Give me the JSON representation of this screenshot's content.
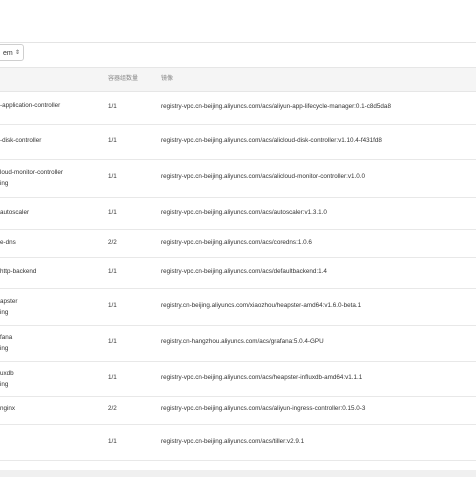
{
  "namespace_select": {
    "value": "em"
  },
  "table": {
    "headers": {
      "name": "",
      "count": "容器组数量",
      "image": "镜像"
    },
    "rows": [
      {
        "name": "-application-controller",
        "sub": "",
        "count": "1/1",
        "image": "registry-vpc.cn-beijing.aliyuncs.com/acs/aliyun-app-lifecycle-manager:0.1-c8d5da8"
      },
      {
        "name": "-disk-controller",
        "sub": "",
        "count": "1/1",
        "image": "registry-vpc.cn-beijing.aliyuncs.com/acs/alicloud-disk-controller:v1.10.4-f431fd8"
      },
      {
        "name": "loud-monitor-controller",
        "sub": "ing",
        "count": "1/1",
        "image": "registry-vpc.cn-beijing.aliyuncs.com/acs/alicloud-monitor-controller:v1.0.0"
      },
      {
        "name": "autoscaler",
        "sub": "",
        "count": "1/1",
        "image": "registry-vpc.cn-beijing.aliyuncs.com/acs/autoscaler:v1.3.1.0"
      },
      {
        "name": "e-dns",
        "sub": "",
        "count": "2/2",
        "image": "registry-vpc.cn-beijing.aliyuncs.com/acs/coredns:1.0.6"
      },
      {
        "name": "http-backend",
        "sub": "",
        "count": "1/1",
        "image": "registry-vpc.cn-beijing.aliyuncs.com/acs/defaultbackend:1.4"
      },
      {
        "name": "apster",
        "sub": "ing",
        "count": "1/1",
        "image": "registry.cn-beijing.aliyuncs.com/xiaozhou/heapster-amd64:v1.6.0-beta.1"
      },
      {
        "name": "fana",
        "sub": "ing",
        "count": "1/1",
        "image": "registry.cn-hangzhou.aliyuncs.com/acs/grafana:5.0.4-GPU"
      },
      {
        "name": "uxdb",
        "sub": "ing",
        "count": "1/1",
        "image": "registry-vpc.cn-beijing.aliyuncs.com/acs/heapster-influxdb-amd64:v1.1.1"
      },
      {
        "name": "nginx",
        "sub": "",
        "count": "2/2",
        "image": "registry-vpc.cn-beijing.aliyuncs.com/acs/aliyun-ingress-controller:0.15.0-3"
      },
      {
        "name": "",
        "sub": "",
        "count": "1/1",
        "image": "registry-vpc.cn-beijing.aliyuncs.com/acs/tiller:v2.9.1"
      }
    ]
  }
}
